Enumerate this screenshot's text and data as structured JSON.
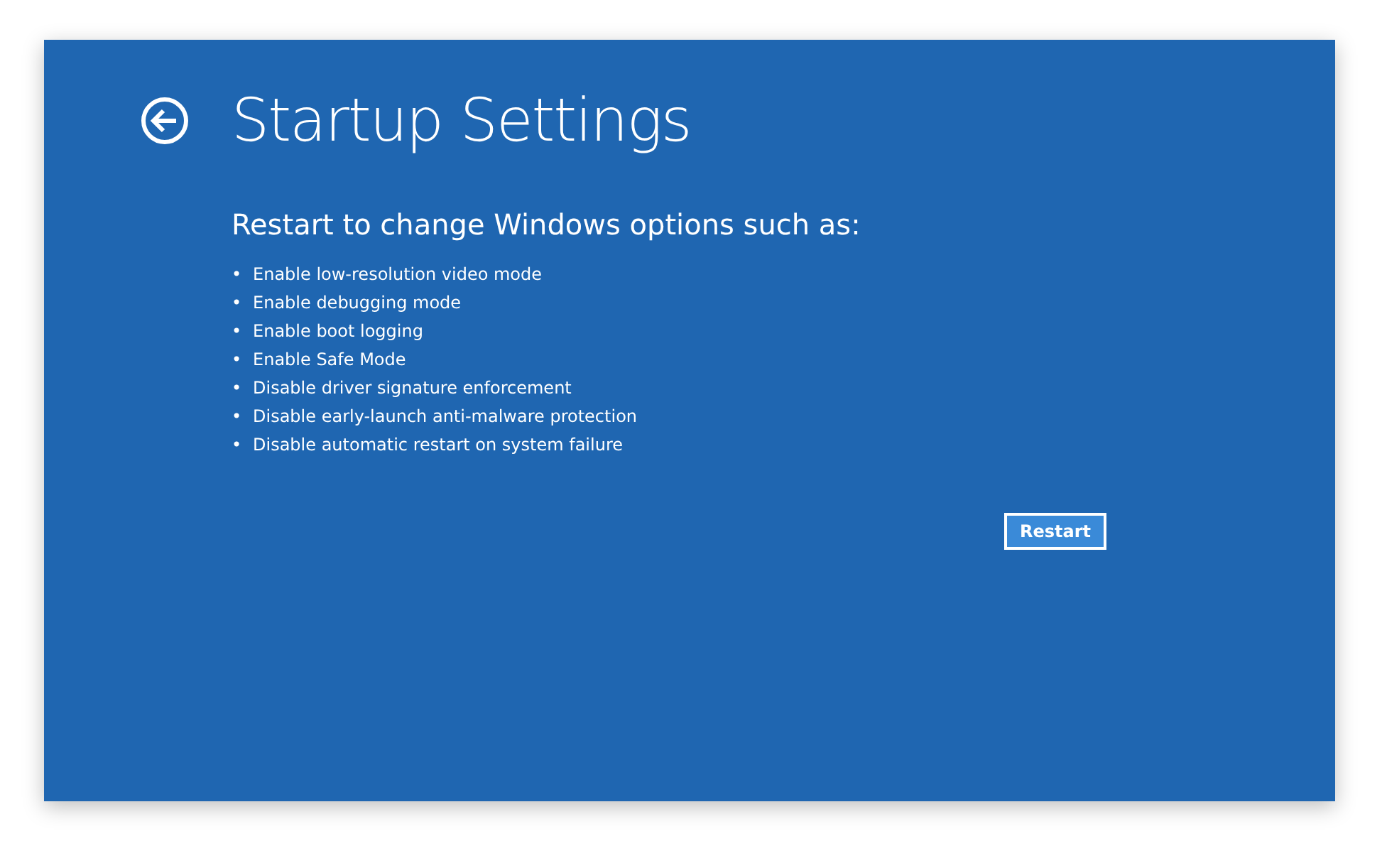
{
  "title": "Startup Settings",
  "subtitle": "Restart to change Windows options such as:",
  "options": [
    {
      "bullet": "•",
      "label": "Enable low-resolution video mode"
    },
    {
      "bullet": "•",
      "label": "Enable debugging mode"
    },
    {
      "bullet": "•",
      "label": "Enable boot logging"
    },
    {
      "bullet": "•",
      "label": "Enable Safe Mode"
    },
    {
      "bullet": "•",
      "label": "Disable driver signature enforcement"
    },
    {
      "bullet": "•",
      "label": "Disable early-launch anti-malware protection"
    },
    {
      "bullet": "•",
      "label": "Disable automatic restart on system failure"
    }
  ],
  "button": "Restart"
}
